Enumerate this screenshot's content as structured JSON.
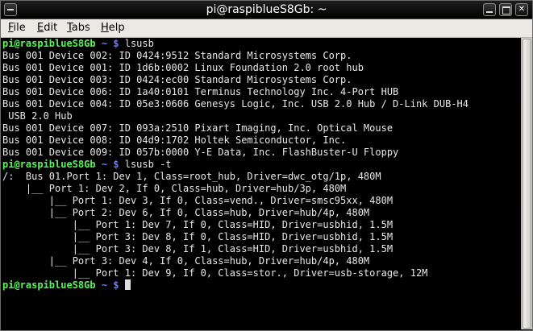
{
  "window": {
    "title": "pi@raspiblueS8Gb: ~"
  },
  "menu": {
    "file": {
      "mnemonic": "F",
      "rest": "ile"
    },
    "edit": {
      "mnemonic": "E",
      "rest": "dit"
    },
    "tabs": {
      "mnemonic": "T",
      "rest": "abs"
    },
    "help": {
      "mnemonic": "H",
      "rest": "elp"
    }
  },
  "prompt": {
    "user": "pi@raspiblueS8Gb",
    "path": " ~ $ "
  },
  "terminal": {
    "cmd1": "lsusb",
    "lsusb_output": [
      "Bus 001 Device 002: ID 0424:9512 Standard Microsystems Corp.",
      "Bus 001 Device 001: ID 1d6b:0002 Linux Foundation 2.0 root hub",
      "Bus 001 Device 003: ID 0424:ec00 Standard Microsystems Corp.",
      "Bus 001 Device 006: ID 1a40:0101 Terminus Technology Inc. 4-Port HUB",
      "Bus 001 Device 004: ID 05e3:0606 Genesys Logic, Inc. USB 2.0 Hub / D-Link DUB-H4",
      " USB 2.0 Hub",
      "Bus 001 Device 007: ID 093a:2510 Pixart Imaging, Inc. Optical Mouse",
      "Bus 001 Device 008: ID 04d9:1702 Holtek Semiconductor, Inc.",
      "Bus 001 Device 009: ID 057b:0000 Y-E Data, Inc. FlashBuster-U Floppy"
    ],
    "cmd2": "lsusb -t",
    "tree_output": [
      "/:  Bus 01.Port 1: Dev 1, Class=root_hub, Driver=dwc_otg/1p, 480M",
      "    |__ Port 1: Dev 2, If 0, Class=hub, Driver=hub/3p, 480M",
      "        |__ Port 1: Dev 3, If 0, Class=vend., Driver=smsc95xx, 480M",
      "        |__ Port 2: Dev 6, If 0, Class=hub, Driver=hub/4p, 480M",
      "            |__ Port 1: Dev 7, If 0, Class=HID, Driver=usbhid, 1.5M",
      "            |__ Port 3: Dev 8, If 0, Class=HID, Driver=usbhid, 1.5M",
      "            |__ Port 3: Dev 8, If 1, Class=HID, Driver=usbhid, 1.5M",
      "        |__ Port 3: Dev 4, If 0, Class=hub, Driver=hub/4p, 480M",
      "            |__ Port 1: Dev 9, If 0, Class=stor., Driver=usb-storage, 12M"
    ]
  },
  "icons": {
    "window_menu": "window-menu-icon",
    "minimize": "minimize-icon",
    "maximize": "maximize-icon",
    "close": "close-icon",
    "close_glyph": "✕"
  },
  "colors": {
    "prompt_user": "#5af25a",
    "prompt_path": "#6f7cff",
    "terminal_bg": "#000000",
    "terminal_fg": "#e8e8e8",
    "menubar_bg": "#ece9e4"
  }
}
